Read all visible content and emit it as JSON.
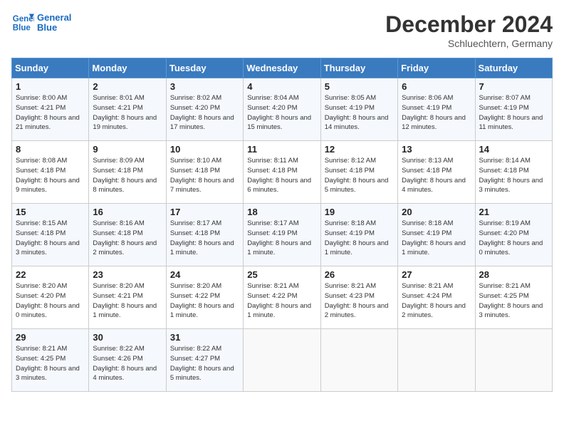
{
  "header": {
    "logo_line1": "General",
    "logo_line2": "Blue",
    "month": "December 2024",
    "location": "Schluechtern, Germany"
  },
  "days_of_week": [
    "Sunday",
    "Monday",
    "Tuesday",
    "Wednesday",
    "Thursday",
    "Friday",
    "Saturday"
  ],
  "weeks": [
    [
      {
        "day": "1",
        "sunrise": "Sunrise: 8:00 AM",
        "sunset": "Sunset: 4:21 PM",
        "daylight": "Daylight: 8 hours and 21 minutes."
      },
      {
        "day": "2",
        "sunrise": "Sunrise: 8:01 AM",
        "sunset": "Sunset: 4:21 PM",
        "daylight": "Daylight: 8 hours and 19 minutes."
      },
      {
        "day": "3",
        "sunrise": "Sunrise: 8:02 AM",
        "sunset": "Sunset: 4:20 PM",
        "daylight": "Daylight: 8 hours and 17 minutes."
      },
      {
        "day": "4",
        "sunrise": "Sunrise: 8:04 AM",
        "sunset": "Sunset: 4:20 PM",
        "daylight": "Daylight: 8 hours and 15 minutes."
      },
      {
        "day": "5",
        "sunrise": "Sunrise: 8:05 AM",
        "sunset": "Sunset: 4:19 PM",
        "daylight": "Daylight: 8 hours and 14 minutes."
      },
      {
        "day": "6",
        "sunrise": "Sunrise: 8:06 AM",
        "sunset": "Sunset: 4:19 PM",
        "daylight": "Daylight: 8 hours and 12 minutes."
      },
      {
        "day": "7",
        "sunrise": "Sunrise: 8:07 AM",
        "sunset": "Sunset: 4:19 PM",
        "daylight": "Daylight: 8 hours and 11 minutes."
      }
    ],
    [
      {
        "day": "8",
        "sunrise": "Sunrise: 8:08 AM",
        "sunset": "Sunset: 4:18 PM",
        "daylight": "Daylight: 8 hours and 9 minutes."
      },
      {
        "day": "9",
        "sunrise": "Sunrise: 8:09 AM",
        "sunset": "Sunset: 4:18 PM",
        "daylight": "Daylight: 8 hours and 8 minutes."
      },
      {
        "day": "10",
        "sunrise": "Sunrise: 8:10 AM",
        "sunset": "Sunset: 4:18 PM",
        "daylight": "Daylight: 8 hours and 7 minutes."
      },
      {
        "day": "11",
        "sunrise": "Sunrise: 8:11 AM",
        "sunset": "Sunset: 4:18 PM",
        "daylight": "Daylight: 8 hours and 6 minutes."
      },
      {
        "day": "12",
        "sunrise": "Sunrise: 8:12 AM",
        "sunset": "Sunset: 4:18 PM",
        "daylight": "Daylight: 8 hours and 5 minutes."
      },
      {
        "day": "13",
        "sunrise": "Sunrise: 8:13 AM",
        "sunset": "Sunset: 4:18 PM",
        "daylight": "Daylight: 8 hours and 4 minutes."
      },
      {
        "day": "14",
        "sunrise": "Sunrise: 8:14 AM",
        "sunset": "Sunset: 4:18 PM",
        "daylight": "Daylight: 8 hours and 3 minutes."
      }
    ],
    [
      {
        "day": "15",
        "sunrise": "Sunrise: 8:15 AM",
        "sunset": "Sunset: 4:18 PM",
        "daylight": "Daylight: 8 hours and 3 minutes."
      },
      {
        "day": "16",
        "sunrise": "Sunrise: 8:16 AM",
        "sunset": "Sunset: 4:18 PM",
        "daylight": "Daylight: 8 hours and 2 minutes."
      },
      {
        "day": "17",
        "sunrise": "Sunrise: 8:17 AM",
        "sunset": "Sunset: 4:18 PM",
        "daylight": "Daylight: 8 hours and 1 minute."
      },
      {
        "day": "18",
        "sunrise": "Sunrise: 8:17 AM",
        "sunset": "Sunset: 4:19 PM",
        "daylight": "Daylight: 8 hours and 1 minute."
      },
      {
        "day": "19",
        "sunrise": "Sunrise: 8:18 AM",
        "sunset": "Sunset: 4:19 PM",
        "daylight": "Daylight: 8 hours and 1 minute."
      },
      {
        "day": "20",
        "sunrise": "Sunrise: 8:18 AM",
        "sunset": "Sunset: 4:19 PM",
        "daylight": "Daylight: 8 hours and 1 minute."
      },
      {
        "day": "21",
        "sunrise": "Sunrise: 8:19 AM",
        "sunset": "Sunset: 4:20 PM",
        "daylight": "Daylight: 8 hours and 0 minutes."
      }
    ],
    [
      {
        "day": "22",
        "sunrise": "Sunrise: 8:20 AM",
        "sunset": "Sunset: 4:20 PM",
        "daylight": "Daylight: 8 hours and 0 minutes."
      },
      {
        "day": "23",
        "sunrise": "Sunrise: 8:20 AM",
        "sunset": "Sunset: 4:21 PM",
        "daylight": "Daylight: 8 hours and 1 minute."
      },
      {
        "day": "24",
        "sunrise": "Sunrise: 8:20 AM",
        "sunset": "Sunset: 4:22 PM",
        "daylight": "Daylight: 8 hours and 1 minute."
      },
      {
        "day": "25",
        "sunrise": "Sunrise: 8:21 AM",
        "sunset": "Sunset: 4:22 PM",
        "daylight": "Daylight: 8 hours and 1 minute."
      },
      {
        "day": "26",
        "sunrise": "Sunrise: 8:21 AM",
        "sunset": "Sunset: 4:23 PM",
        "daylight": "Daylight: 8 hours and 2 minutes."
      },
      {
        "day": "27",
        "sunrise": "Sunrise: 8:21 AM",
        "sunset": "Sunset: 4:24 PM",
        "daylight": "Daylight: 8 hours and 2 minutes."
      },
      {
        "day": "28",
        "sunrise": "Sunrise: 8:21 AM",
        "sunset": "Sunset: 4:25 PM",
        "daylight": "Daylight: 8 hours and 3 minutes."
      }
    ],
    [
      {
        "day": "29",
        "sunrise": "Sunrise: 8:21 AM",
        "sunset": "Sunset: 4:25 PM",
        "daylight": "Daylight: 8 hours and 3 minutes."
      },
      {
        "day": "30",
        "sunrise": "Sunrise: 8:22 AM",
        "sunset": "Sunset: 4:26 PM",
        "daylight": "Daylight: 8 hours and 4 minutes."
      },
      {
        "day": "31",
        "sunrise": "Sunrise: 8:22 AM",
        "sunset": "Sunset: 4:27 PM",
        "daylight": "Daylight: 8 hours and 5 minutes."
      },
      null,
      null,
      null,
      null
    ]
  ]
}
